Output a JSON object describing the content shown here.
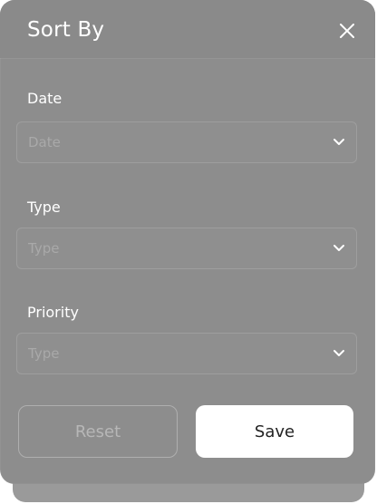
{
  "modal": {
    "title": "Sort By",
    "close_icon": "close-icon"
  },
  "fields": [
    {
      "label": "Date",
      "placeholder": "Date"
    },
    {
      "label": "Type",
      "placeholder": "Type"
    },
    {
      "label": "Priority",
      "placeholder": "Type"
    }
  ],
  "buttons": {
    "reset_label": "Reset",
    "save_label": "Save"
  },
  "colors": {
    "modal_bg": "#8d8d8d",
    "save_bg": "#ffffff",
    "text": "#ffffff"
  }
}
